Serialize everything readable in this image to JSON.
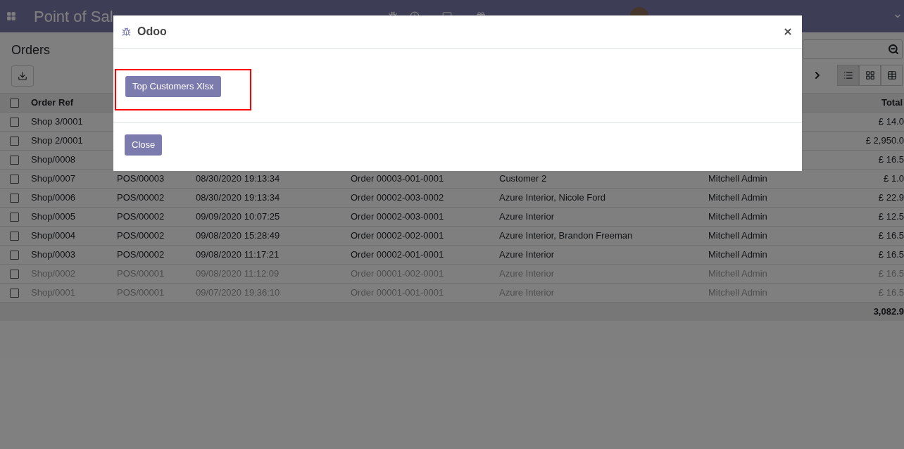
{
  "navbar": {
    "app_title": "Point of Sal"
  },
  "control_panel": {
    "title": "Orders",
    "views": [
      {
        "kind": "list",
        "selected": true
      },
      {
        "kind": "kanban",
        "selected": false
      },
      {
        "kind": "pivot",
        "selected": false
      }
    ]
  },
  "table": {
    "columns": [
      "Order Ref",
      "Total"
    ],
    "select_all": false,
    "rows": [
      {
        "order_ref": "Shop 3/0001",
        "total": "£ 14.0",
        "muted": false,
        "checked": false
      },
      {
        "order_ref": "Shop 2/0001",
        "total": "£ 2,950.0",
        "muted": false,
        "checked": false
      },
      {
        "order_ref": "Shop/0008",
        "total": "£ 16.5",
        "muted": false,
        "checked": false
      },
      {
        "order_ref": "Shop/0007",
        "column_2": "POS/00003",
        "column_3": "08/30/2020 19:13:34",
        "column_4": "Order 00003-001-0001",
        "column_5": "Customer 2",
        "column_6": "Mitchell Admin",
        "total": "£ 1.0",
        "muted": false,
        "checked": false
      },
      {
        "order_ref": "Shop/0006",
        "column_2": "POS/00002",
        "column_3": "08/30/2020 19:13:34",
        "column_4": "Order 00002-003-0002",
        "column_5": "Azure Interior, Nicole Ford",
        "column_6": "Mitchell Admin",
        "total": "£ 22.9",
        "muted": false,
        "checked": false
      },
      {
        "order_ref": "Shop/0005",
        "column_2": "POS/00002",
        "column_3": "09/09/2020 10:07:25",
        "column_4": "Order 00002-003-0001",
        "column_5": "Azure Interior",
        "column_6": "Mitchell Admin",
        "total": "£ 12.5",
        "muted": false,
        "checked": false
      },
      {
        "order_ref": "Shop/0004",
        "column_2": "POS/00002",
        "column_3": "09/08/2020 15:28:49",
        "column_4": "Order 00002-002-0001",
        "column_5": "Azure Interior, Brandon Freeman",
        "column_6": "Mitchell Admin",
        "total": "£ 16.5",
        "muted": false,
        "checked": false
      },
      {
        "order_ref": "Shop/0003",
        "column_2": "POS/00002",
        "column_3": "09/08/2020 11:17:21",
        "column_4": "Order 00002-001-0001",
        "column_5": "Azure Interior",
        "column_6": "Mitchell Admin",
        "total": "£ 16.5",
        "muted": false,
        "checked": false
      },
      {
        "order_ref": "Shop/0002",
        "column_2": "POS/00001",
        "column_3": "09/08/2020 11:12:09",
        "column_4": "Order 00001-002-0001",
        "column_5": "Azure Interior",
        "column_6": "Mitchell Admin",
        "total": "£ 16.5",
        "muted": true,
        "checked": false
      },
      {
        "order_ref": "Shop/0001",
        "column_2": "POS/00001",
        "column_3": "09/07/2020 19:36:10",
        "column_4": "Order 00001-001-0001",
        "column_5": "Azure Interior",
        "column_6": "Mitchell Admin",
        "total": "£ 16.5",
        "muted": true,
        "checked": false
      }
    ],
    "sum": "3,082.9"
  },
  "dialog": {
    "title": "Odoo",
    "report_button": "Top Customers Xlsx",
    "close_button": "Close"
  }
}
